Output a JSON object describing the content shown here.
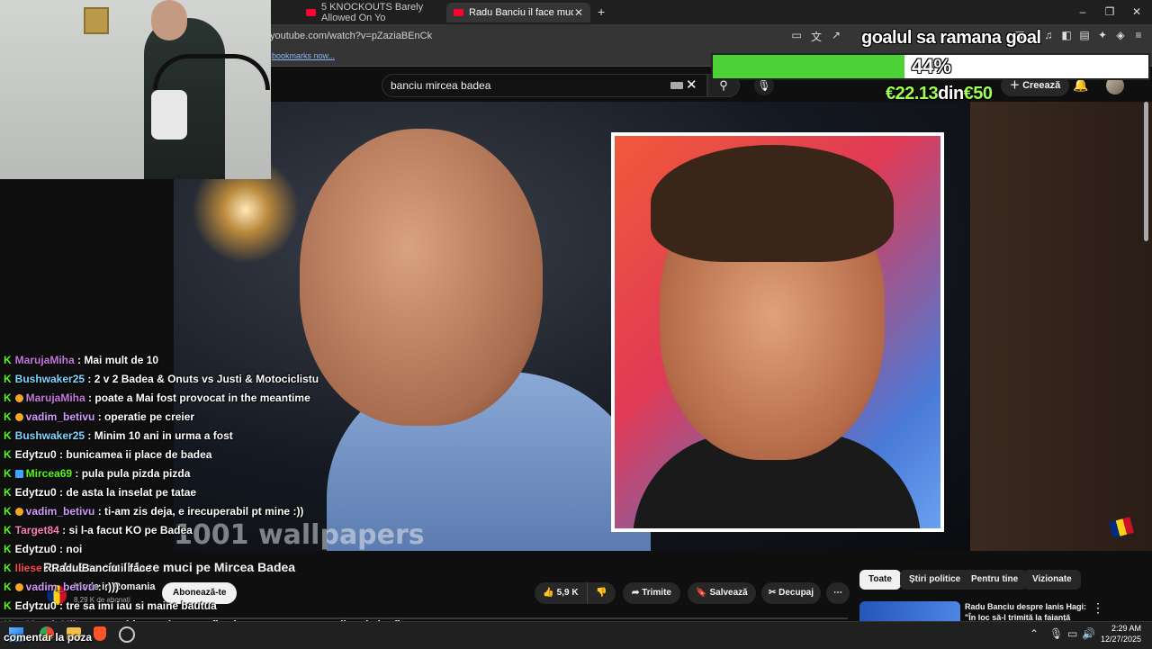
{
  "browser": {
    "tabs": [
      {
        "label": "5 KNOCKOUTS Barely Allowed On Yo",
        "active": false
      },
      {
        "label": "Radu Banciu il face muci pe Mirc",
        "active": true
      }
    ],
    "new_tab": "+",
    "url": "youtube.com/watch?v=pZaziaBEnCk",
    "bookmarks_prompt": "bookmarks now...",
    "window_controls": [
      "–",
      "❐",
      "✕"
    ]
  },
  "youtube": {
    "search_value": "banciu mircea badea",
    "create_label": "Creează",
    "video_watermark": "1001 wallpapers",
    "video_title": "Radu Banciu il face muci pe Mircea Badea",
    "channel_name": "Made in Romania",
    "subscribers": "8,29 K de abonați",
    "subscribe_label": "Abonează-te",
    "likes": "5,9 K",
    "share_label": "Trimite",
    "save_label": "Salvează",
    "clip_label": "Decupaj",
    "chips": [
      "Toate",
      "Știri politice",
      "Pentru tine",
      "Vizionate"
    ],
    "recommended_title": "Radu Banciu despre Ianis Hagi: \"În loc să-l trimită la faianță"
  },
  "donation_goal": {
    "title": "goalul sa ramana goal",
    "percent": 44,
    "percent_label": "44%",
    "raised": "€22.13",
    "separator": "din",
    "target": "€50",
    "fill_color": "#4cd137"
  },
  "chat": [
    {
      "user": "MarujaMiha",
      "color": "#c678dd",
      "badges": "",
      "text": "Mai mult de 10"
    },
    {
      "user": "Bushwaker25",
      "color": "#7fd6ff",
      "badges": "",
      "text": "2 v 2 Badea & Onuts vs Justi & Motociclistu"
    },
    {
      "user": "MarujaMiha",
      "color": "#c678dd",
      "badges": "dot",
      "text": "poate a Mai fost provocat in the meantime"
    },
    {
      "user": "vadim_betivu",
      "color": "#d29cff",
      "badges": "coin",
      "text": "operatie pe creier"
    },
    {
      "user": "Bushwaker25",
      "color": "#7fd6ff",
      "badges": "",
      "text": "Minim 10 ani in urma a fost"
    },
    {
      "user": "Edytzu0",
      "color": "#ffffff",
      "badges": "",
      "text": "bunicamea ii place de badea"
    },
    {
      "user": "Mirceа69",
      "color": "#53fc18",
      "badges": "multi",
      "text": "pula pula pizda pizda"
    },
    {
      "user": "Edytzu0",
      "color": "#ffffff",
      "badges": "",
      "text": "de asta la inselat pe tatae"
    },
    {
      "user": "vadim_betivu",
      "color": "#d29cff",
      "badges": "coin",
      "text": "ti-am zis deja, e irecuperabil pt mine :))"
    },
    {
      "user": "Target84",
      "color": "#ff7eb6",
      "badges": "",
      "text": "si l-a facut KO pe Badea"
    },
    {
      "user": "Edytzu0",
      "color": "#ffffff",
      "badges": "",
      "text": "noi"
    },
    {
      "user": "Iliese",
      "color": "#ff4d4d",
      "badges": "",
      "text": "Radu Banciu il face"
    },
    {
      "user": "vadim_betivu",
      "color": "#d29cff",
      "badges": "coin",
      "text": ":)))"
    },
    {
      "user": "Edytzu0",
      "color": "#ffffff",
      "badges": "",
      "text": "tre sa imi iau si maine bautua"
    },
    {
      "user": "MarujaMiha",
      "color": "#c678dd",
      "badges": "dot",
      "text": "me neither ... da tre sa fie cineva cu prezenta online de i-o fi"
    }
  ],
  "overlay_bottom_text": "comentar la poza",
  "taskbar": {
    "time": "2:29 AM",
    "date": "12/27/2025"
  }
}
